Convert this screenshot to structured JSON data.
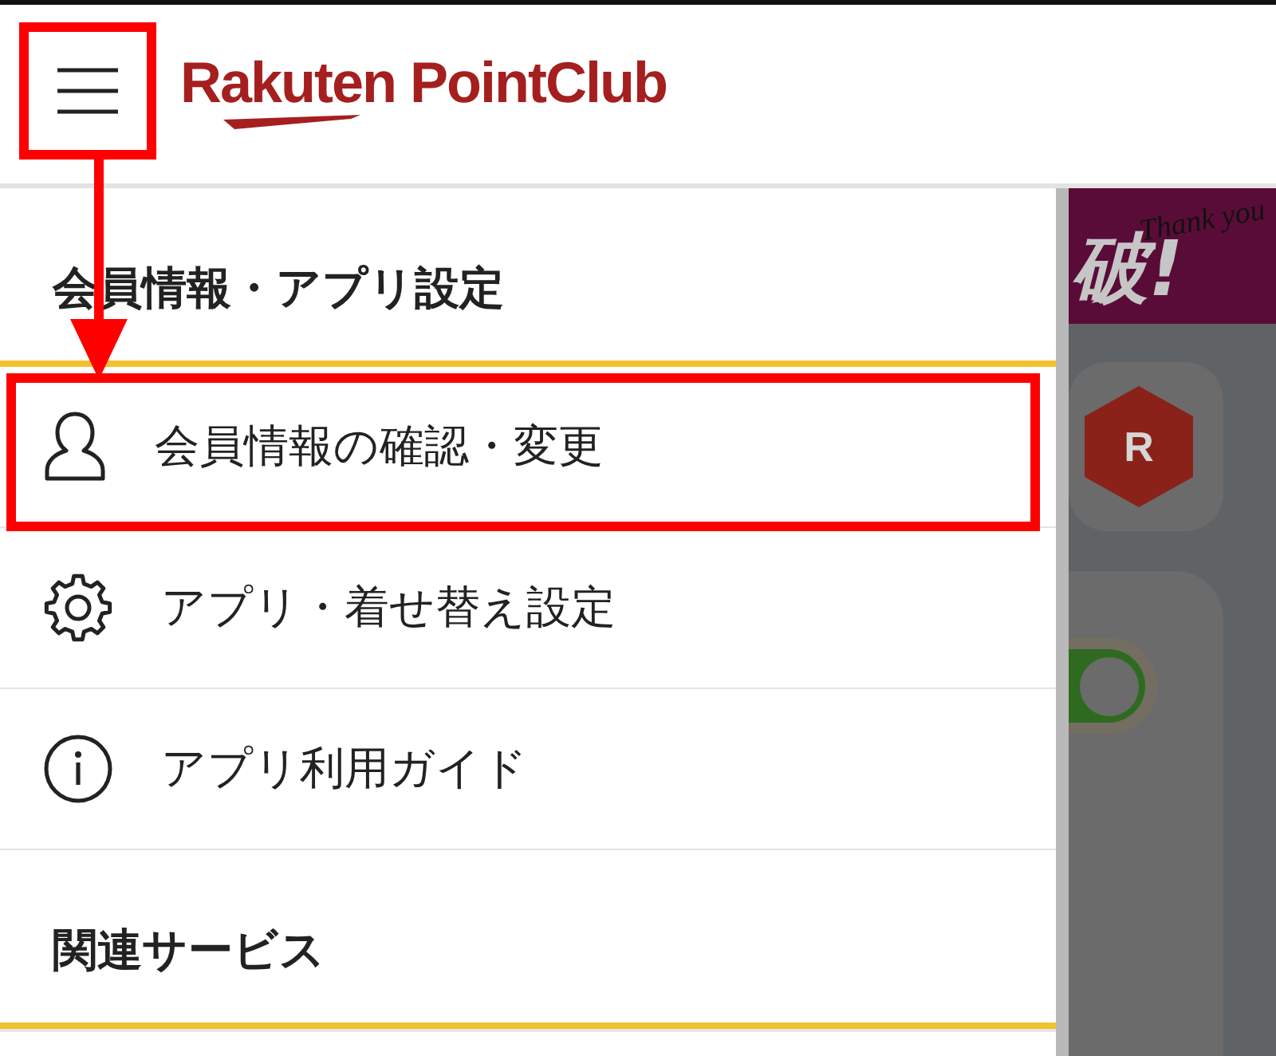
{
  "header": {
    "menu_button": {
      "highlighted": true
    },
    "logo": "Rakuten PointClub"
  },
  "annotation_arrow": true,
  "drawer": {
    "sections": [
      {
        "title": "会員情報・アプリ設定",
        "items": [
          {
            "kind": "profile",
            "label": "会員情報の確認・変更",
            "highlighted": true
          },
          {
            "kind": "settings",
            "label": "アプリ・着せ替え設定",
            "highlighted": false
          },
          {
            "kind": "guide",
            "label": "アプリ利用ガイド",
            "highlighted": false
          }
        ]
      },
      {
        "title": "関連サービス"
      }
    ]
  },
  "background": {
    "banner": {
      "text": "破!",
      "script_text": "Thank you"
    },
    "app_icon": {
      "letter": "R"
    },
    "toggle": {
      "on": true
    }
  }
}
